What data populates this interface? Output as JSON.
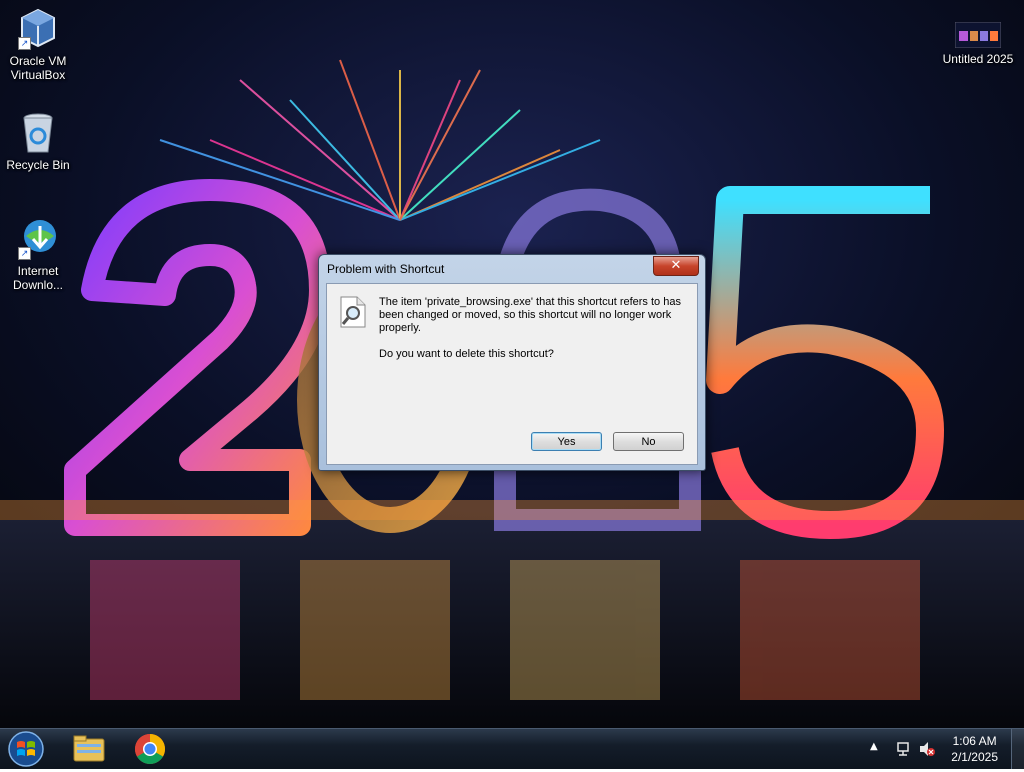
{
  "desktop": {
    "icons": [
      {
        "label": "Oracle VM\nVirtualBox",
        "icon": "virtualbox-icon"
      },
      {
        "label": "Recycle Bin",
        "icon": "recycle-bin-icon"
      },
      {
        "label": "Internet\nDownlo...",
        "icon": "internet-download-manager-icon"
      },
      {
        "label": "Untitled 2025",
        "icon": "image-file-icon"
      }
    ],
    "wallpaper_text": "2025"
  },
  "dialog": {
    "title": "Problem with Shortcut",
    "close_label": "✕",
    "message": "The item 'private_browsing.exe' that this shortcut refers to has been changed or moved, so this shortcut will no longer work properly.",
    "question": "Do you want to delete this shortcut?",
    "yes_label": "Yes",
    "no_label": "No"
  },
  "taskbar": {
    "pinned": [
      "start-orb-icon",
      "file-explorer-icon",
      "chrome-icon"
    ],
    "tray": {
      "time": "1:06 AM",
      "date": "2/1/2025"
    }
  },
  "colors": {
    "dialog_frame": "#a9c0dc",
    "taskbar": "#141d2a",
    "close_button": "#c7442b"
  }
}
